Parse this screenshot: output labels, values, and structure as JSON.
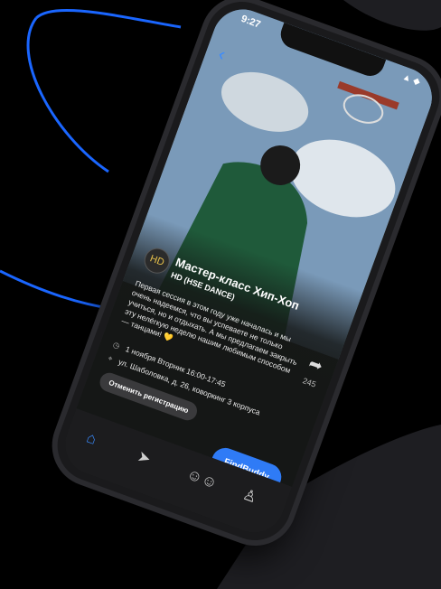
{
  "status": {
    "time": "9:27",
    "icons": "▲ ◆"
  },
  "event": {
    "title": "Мастер-класс Хип-Хоп",
    "organizer": "HD (HSE DANCE)",
    "organizer_avatar_text": "HD",
    "description": "Первая сессия в этом году уже началась и мы очень надеемся, что вы успеваете не только учиться, но и отдыхать. А мы предлагаем закрыть эту нелёгкую неделю нашим любимым способом — танцами! 💛",
    "date": "1 ноября Вторник 16:00-17:45",
    "address": "ул. Шаболовка, д. 26, коворкинг 3 корпуса",
    "share_count": "245"
  },
  "buttons": {
    "cancel": "Отменить регистрацию",
    "findbuddy": "FindBuddy"
  },
  "tabs": [
    "home",
    "send",
    "people",
    "profile"
  ],
  "colors": {
    "accent": "#2f7bf6",
    "wave": "#1a66ff"
  }
}
